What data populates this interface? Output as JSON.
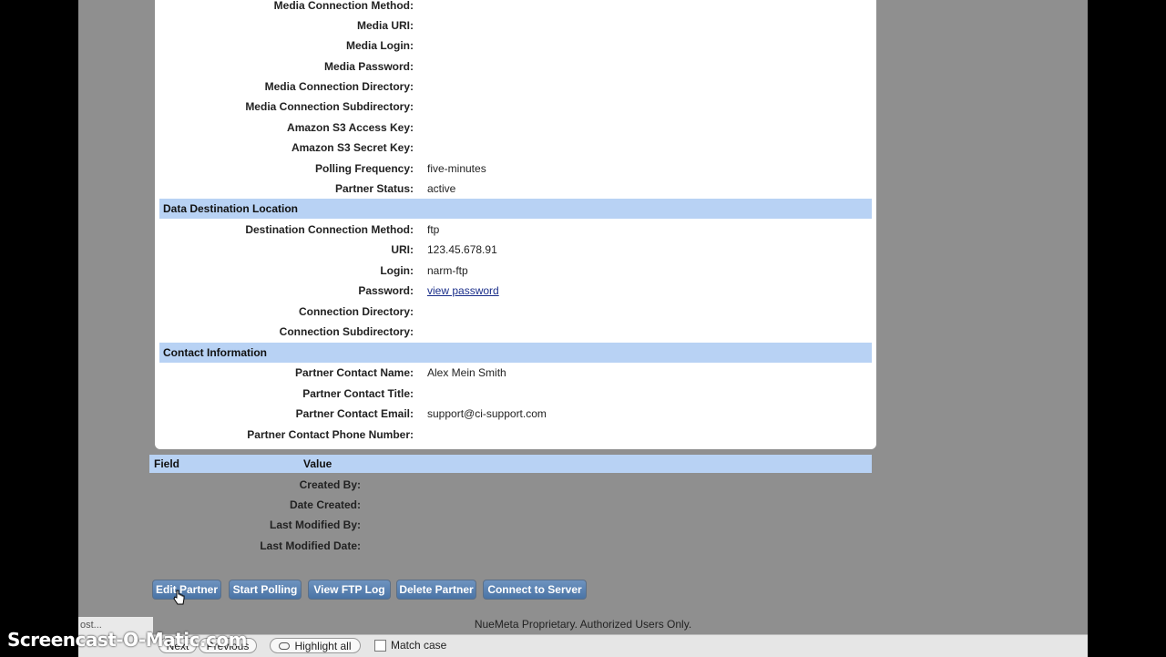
{
  "source": {
    "rows": [
      {
        "label": "Media Connection Method:",
        "value": ""
      },
      {
        "label": "Media URI:",
        "value": ""
      },
      {
        "label": "Media Login:",
        "value": ""
      },
      {
        "label": "Media Password:",
        "value": ""
      },
      {
        "label": "Media Connection Directory:",
        "value": ""
      },
      {
        "label": "Media Connection Subdirectory:",
        "value": ""
      },
      {
        "label": "Amazon S3 Access Key:",
        "value": ""
      },
      {
        "label": "Amazon S3 Secret Key:",
        "value": ""
      },
      {
        "label": "Polling Frequency:",
        "value": "five-minutes"
      },
      {
        "label": "Partner Status:",
        "value": "active"
      }
    ]
  },
  "destination": {
    "title": "Data Destination Location",
    "rows": [
      {
        "label": "Destination Connection Method:",
        "value": "ftp"
      },
      {
        "label": "URI:",
        "value": "123.45.678.91"
      },
      {
        "label": "Login:",
        "value": "narm-ftp"
      },
      {
        "label": "Password:",
        "link": "view password"
      },
      {
        "label": "Connection Directory:",
        "value": ""
      },
      {
        "label": "Connection Subdirectory:",
        "value": ""
      }
    ]
  },
  "contact": {
    "title": "Contact Information",
    "rows": [
      {
        "label": "Partner Contact Name:",
        "value": "Alex Mein Smith"
      },
      {
        "label": "Partner Contact Title:",
        "value": ""
      },
      {
        "label": "Partner Contact Email:",
        "value": "support@ci-support.com"
      },
      {
        "label": "Partner Contact Phone Number:",
        "value": ""
      }
    ]
  },
  "meta": {
    "col_field": "Field",
    "col_value": "Value",
    "rows": [
      {
        "label": "Created By:"
      },
      {
        "label": "Date Created:"
      },
      {
        "label": "Last Modified By:"
      },
      {
        "label": "Last Modified Date:"
      }
    ]
  },
  "buttons": {
    "edit": "Edit Partner",
    "start_polling": "Start Polling",
    "ftp_log": "View FTP Log",
    "delete": "Delete Partner",
    "connect": "Connect to Server"
  },
  "footer": "NueMeta Proprietary. Authorized Users Only.",
  "findbar": {
    "search_ghost": "ost...",
    "next": "Next",
    "previous": "Previous",
    "highlight_all": "Highlight all",
    "match_case": "Match case"
  },
  "watermark": "Screencast-O-Matic.com",
  "colors": {
    "section_bg": "#b8d2f4",
    "button": "#4a74a6"
  }
}
